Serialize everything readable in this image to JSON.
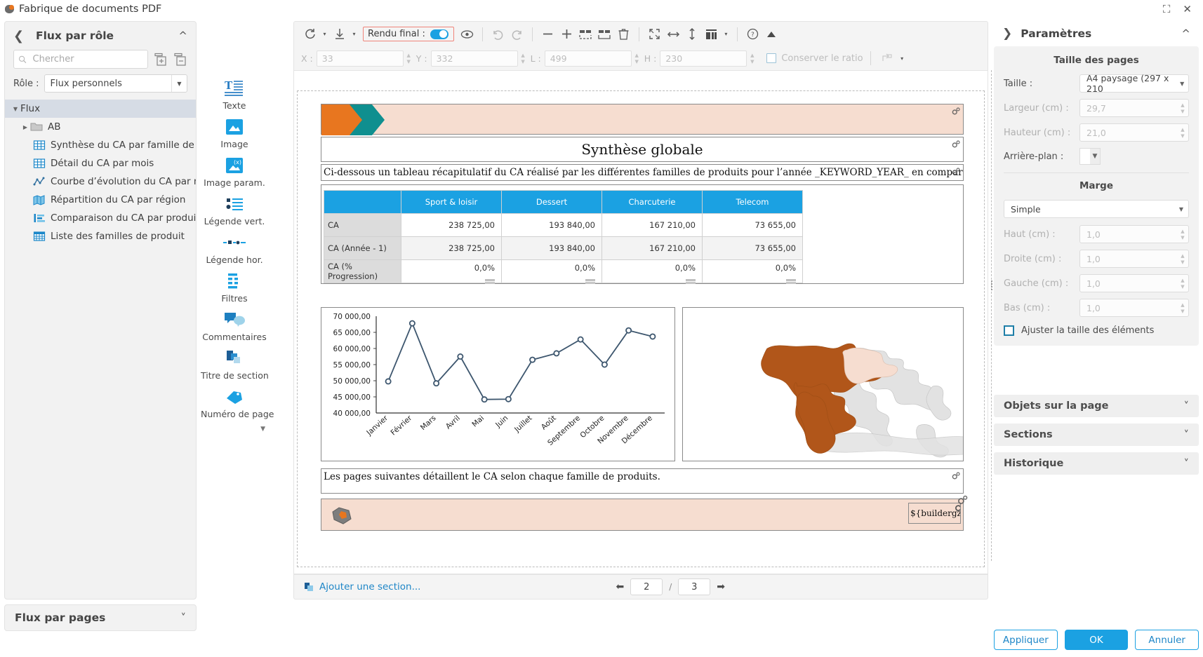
{
  "window": {
    "title": "Fabrique de documents PDF",
    "app_icon": "app-logo-icon",
    "maximize_label": "⛶",
    "close_label": "✕"
  },
  "left_panel": {
    "back_icon": "chevron-left-icon",
    "title": "Flux par rôle",
    "collapse_icon": "chevron-up-icon",
    "search": {
      "placeholder": "Chercher",
      "value": ""
    },
    "expand_all_icon": "expand-all-icon",
    "collapse_all_icon": "collapse-all-icon",
    "role_label": "Rôle :",
    "role_value": "Flux personnels",
    "tree": [
      {
        "label": "Flux",
        "icon": "none",
        "level": 0,
        "twisty": "down",
        "selected": true
      },
      {
        "label": "AB",
        "icon": "folder-icon",
        "level": 1,
        "twisty": "right",
        "selected": false
      },
      {
        "label": "Synthèse du CA par famille de pro",
        "icon": "table-icon",
        "level": 2,
        "twisty": "",
        "selected": false
      },
      {
        "label": "Détail du CA par mois",
        "icon": "table-icon",
        "level": 2,
        "twisty": "",
        "selected": false
      },
      {
        "label": "Courbe d’évolution du CA par mo",
        "icon": "line-chart-icon",
        "level": 2,
        "twisty": "",
        "selected": false
      },
      {
        "label": "Répartition du CA par région",
        "icon": "map-icon",
        "level": 2,
        "twisty": "",
        "selected": false
      },
      {
        "label": "Comparaison du CA par produit",
        "icon": "bar-chart-icon",
        "level": 2,
        "twisty": "",
        "selected": false
      },
      {
        "label": "Liste des familles de produit",
        "icon": "grid-icon",
        "level": 2,
        "twisty": "",
        "selected": false
      }
    ],
    "bottom_title": "Flux par pages",
    "bottom_collapse_icon": "chevron-down-icon"
  },
  "palette": {
    "items": [
      {
        "label": "Texte",
        "icon": "text-icon"
      },
      {
        "label": "Image",
        "icon": "image-icon"
      },
      {
        "label": "Image param.",
        "icon": "image-param-icon"
      },
      {
        "label": "Légende vert.",
        "icon": "legend-vertical-icon"
      },
      {
        "label": "Légende hor.",
        "icon": "legend-horizontal-icon"
      },
      {
        "label": "Filtres",
        "icon": "filters-icon"
      },
      {
        "label": "Commentaires",
        "icon": "comments-icon"
      },
      {
        "label": "Titre de section",
        "icon": "section-title-icon"
      },
      {
        "label": "Numéro de page",
        "icon": "page-number-icon"
      }
    ],
    "more_icon": "chevron-down-icon"
  },
  "toolbar": {
    "refresh_icon": "refresh-icon",
    "refresh_caret": "▾",
    "download_icon": "download-icon",
    "download_caret": "▾",
    "render_label": "Rendu final :",
    "render_toggle_on": true,
    "preview_icon": "eye-icon",
    "undo_icon": "undo-icon",
    "redo_icon": "redo-icon",
    "zoom_out_icon": "minus-icon",
    "zoom_in_icon": "plus-icon",
    "add_row_icon": "insert-above-icon",
    "add_col_icon": "insert-below-icon",
    "delete_icon": "trash-icon",
    "fit_icon": "fit-screen-icon",
    "fit_width_icon": "fit-width-icon",
    "fit_height_icon": "fit-height-icon",
    "columns_icon": "columns-icon",
    "columns_caret": "▾",
    "help_icon": "help-icon",
    "collapse_icon": "triangle-up-icon"
  },
  "toolbar2": {
    "x_label": "X :",
    "x_value": "33",
    "y_label": "Y :",
    "y_value": "332",
    "w_label": "L :",
    "w_value": "499",
    "h_label": "H :",
    "h_value": "230",
    "ratio_label": "Conserver le ratio",
    "align_icon": "align-icon",
    "align_caret": "▾"
  },
  "document": {
    "title": "Synthèse globale",
    "intro": "Ci-dessous un tableau récapitulatif du CA réalisé par les différentes familles de produits pour l’année _KEYWORD_YEAR_ en comparaison à l’année précédente.",
    "note": "Les pages suivantes détaillent le CA selon chaque famille de produits.",
    "footer_text": "${buildergz",
    "gear_icon": "gears-icon",
    "table": {
      "columns": [
        "",
        "Sport & loisir",
        "Dessert",
        "Charcuterie",
        "Telecom"
      ],
      "rows": [
        {
          "header": "CA",
          "values": [
            "238 725,00",
            "193 840,00",
            "167 210,00",
            "73 655,00"
          ]
        },
        {
          "header": "CA (Année - 1)",
          "values": [
            "238 725,00",
            "193 840,00",
            "167 210,00",
            "73 655,00"
          ]
        },
        {
          "header": "CA (% Progression)",
          "values": [
            "0,0%",
            "0,0%",
            "0,0%",
            "0,0%"
          ]
        }
      ]
    }
  },
  "chart_data": {
    "type": "line",
    "title": "",
    "xlabel": "",
    "ylabel": "",
    "categories": [
      "Janvier",
      "Février",
      "Mars",
      "Avril",
      "Mai",
      "Juin",
      "Juillet",
      "Août",
      "Septembre",
      "Octobre",
      "Novembre",
      "Décembre"
    ],
    "values": [
      49800,
      67800,
      49200,
      57500,
      44200,
      44300,
      56500,
      58500,
      62800,
      55000,
      65600,
      63700
    ],
    "ytick_labels": [
      "40 000,00",
      "45 000,00",
      "50 000,00",
      "55 000,00",
      "60 000,00",
      "65 000,00",
      "70 000,00"
    ],
    "ylim": [
      40000,
      70000
    ],
    "grid": false,
    "legend": "none",
    "series_color": "#3d566e",
    "marker": "circle-open"
  },
  "map_data": {
    "type": "choropleth",
    "highlight_color": "#b1561a",
    "secondary_color": "#f6ddd0",
    "base_color": "#e0e0e0",
    "highlighted_regions": [
      "North America",
      "South America"
    ],
    "secondary_regions": [
      "Europe"
    ]
  },
  "statusbar": {
    "add_section_icon": "add-section-icon",
    "add_section_label": "Ajouter une section...",
    "prev_icon": "arrow-left-icon",
    "current_page": "2",
    "separator": "/",
    "total_pages": "3",
    "next_icon": "arrow-right-icon"
  },
  "right_panel": {
    "back_icon": "chevron-right-icon",
    "title": "Paramètres",
    "collapse_icon": "chevron-up-icon",
    "page_size_heading": "Taille des pages",
    "size_label": "Taille :",
    "size_value": "A4 paysage (297 x 210",
    "width_label": "Largeur (cm) :",
    "width_value": "29,7",
    "height_label": "Hauteur (cm) :",
    "height_value": "21,0",
    "background_label": "Arrière-plan :",
    "background_value": "",
    "swap_icon": "swap-icon",
    "margin_heading": "Marge",
    "margin_preset": "Simple",
    "top_label": "Haut (cm) :",
    "top_value": "1,0",
    "right_label": "Droite (cm) :",
    "right_value": "1,0",
    "left_label": "Gauche (cm) :",
    "left_value": "1,0",
    "bottom_label": "Bas (cm) :",
    "bottom_value": "1,0",
    "adjust_label": "Ajuster la taille des éléments",
    "adjust_checked": false,
    "accordions": [
      {
        "label": "Objets sur la page",
        "icon": "chevron-down-icon"
      },
      {
        "label": "Sections",
        "icon": "chevron-down-icon"
      },
      {
        "label": "Historique",
        "icon": "chevron-down-icon"
      }
    ],
    "buttons": {
      "apply": "Appliquer",
      "ok": "OK",
      "cancel": "Annuler"
    }
  },
  "colors": {
    "accent": "#1ba1e2",
    "banner": "#f6ddd0",
    "orange": "#e8761f",
    "teal": "#0f8f8f",
    "chart_line": "#3d566e",
    "highlight_border": "#f0847a"
  }
}
